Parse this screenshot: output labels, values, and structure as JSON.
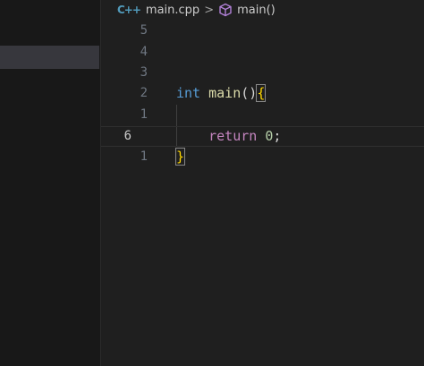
{
  "breadcrumb": {
    "file_icon": "C++",
    "file_name": "main.cpp",
    "separator": ">",
    "symbol_icon": "cube-icon",
    "symbol_name": "main()"
  },
  "editor": {
    "lines": [
      {
        "number": "5",
        "tokens": []
      },
      {
        "number": "4",
        "tokens": []
      },
      {
        "number": "3",
        "tokens": []
      },
      {
        "number": "2",
        "tokens": [
          {
            "type": "keyword-type",
            "text": "int"
          },
          {
            "type": "space",
            "text": " "
          },
          {
            "type": "function",
            "text": "main"
          },
          {
            "type": "punct",
            "text": "()"
          },
          {
            "type": "brace",
            "text": "{"
          }
        ]
      },
      {
        "number": "1",
        "tokens": []
      },
      {
        "number": "6",
        "current": true,
        "tokens": [
          {
            "type": "indent",
            "text": "    "
          },
          {
            "type": "keyword-control",
            "text": "return"
          },
          {
            "type": "space",
            "text": " "
          },
          {
            "type": "number",
            "text": "0"
          },
          {
            "type": "punct",
            "text": ";"
          }
        ]
      },
      {
        "number": "1",
        "tokens": [
          {
            "type": "brace",
            "text": "}"
          }
        ]
      }
    ]
  },
  "colors": {
    "keyword_type": "#569cd6",
    "function": "#dcdcaa",
    "keyword_control": "#c586c0",
    "number": "#b5cea8",
    "bracket": "#ffd700",
    "sidebar_selection": "#37373d"
  }
}
